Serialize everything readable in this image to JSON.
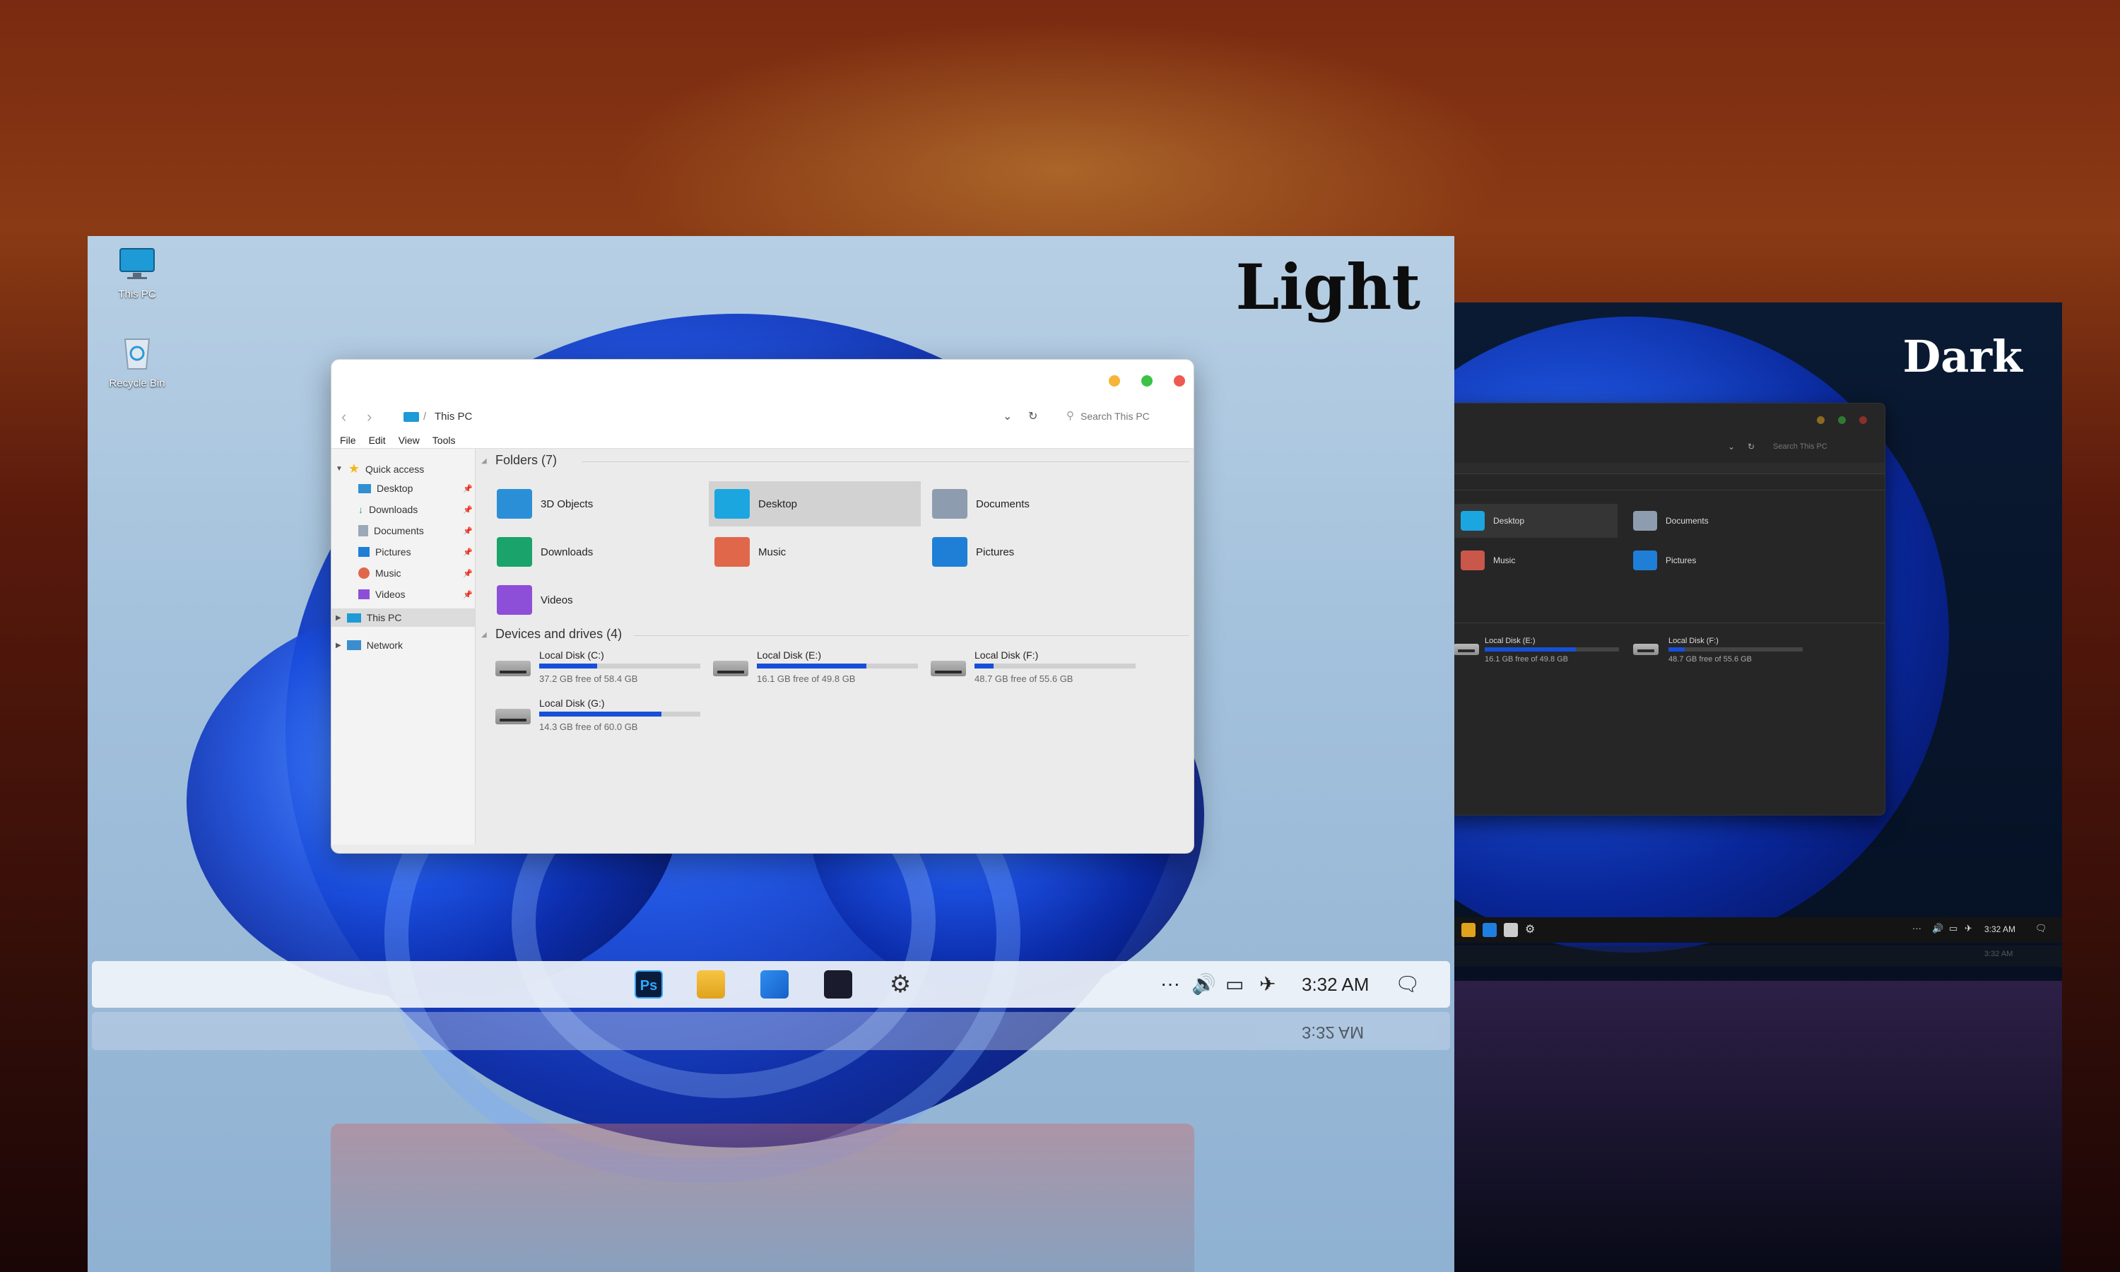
{
  "light": {
    "title": "Light",
    "desktop_icons": [
      {
        "label": "This PC",
        "icon": "monitor-icon"
      },
      {
        "label": "Recycle Bin",
        "icon": "recycle-bin-icon"
      }
    ],
    "window": {
      "breadcrumb": "This PC",
      "search_placeholder": "Search This PC",
      "menu": [
        "File",
        "Edit",
        "View",
        "Tools"
      ],
      "nav": {
        "quick_access": "Quick access",
        "pinned": [
          "Desktop",
          "Downloads",
          "Documents",
          "Pictures",
          "Music",
          "Videos"
        ],
        "this_pc": "This PC",
        "network": "Network"
      },
      "folders_header": "Folders (7)",
      "folders": [
        {
          "name": "3D Objects",
          "icon": "3d-objects-folder-icon"
        },
        {
          "name": "Desktop",
          "icon": "desktop-folder-icon",
          "selected": true
        },
        {
          "name": "Documents",
          "icon": "documents-folder-icon"
        },
        {
          "name": "Downloads",
          "icon": "downloads-folder-icon"
        },
        {
          "name": "Music",
          "icon": "music-folder-icon"
        },
        {
          "name": "Pictures",
          "icon": "pictures-folder-icon"
        },
        {
          "name": "Videos",
          "icon": "videos-folder-icon"
        }
      ],
      "drives_header": "Devices and drives (4)",
      "drives": [
        {
          "name": "Local Disk (C:)",
          "free": "37.2 GB free of 58.4 GB",
          "used_fraction": 0.36
        },
        {
          "name": "Local Disk (E:)",
          "free": "16.1 GB free of 49.8 GB",
          "used_fraction": 0.68
        },
        {
          "name": "Local Disk (F:)",
          "free": "48.7 GB free of 55.6 GB",
          "used_fraction": 0.12
        },
        {
          "name": "Local Disk (G:)",
          "free": "14.3 GB free of 60.0 GB",
          "used_fraction": 0.76
        }
      ]
    },
    "taskbar": {
      "apps": [
        "photoshop-icon",
        "file-explorer-icon",
        "windows-start-icon",
        "store-icon",
        "settings-icon"
      ],
      "photoshop_label": "Ps",
      "overflow": "···",
      "clock": "3:32 AM",
      "reflected_clock": "3:32 AM"
    }
  },
  "dark": {
    "title": "Dark",
    "window": {
      "search_placeholder": "Search This PC",
      "folders": [
        {
          "name": "Desktop",
          "selected": true
        },
        {
          "name": "Documents"
        },
        {
          "name": "Music"
        },
        {
          "name": "Pictures"
        }
      ],
      "drives": [
        {
          "name": "Local Disk (E:)",
          "free": "16.1 GB free of 49.8 GB",
          "used_fraction": 0.68
        },
        {
          "name": "Local Disk (F:)",
          "free": "48.7 GB free of 55.6 GB",
          "used_fraction": 0.12
        }
      ]
    },
    "taskbar": {
      "overflow": "···",
      "clock": "3:32 AM",
      "reflected_clock": "3:32 AM"
    }
  },
  "colors": {
    "accent": "#1750d8",
    "close": "#ee5a52",
    "minimize": "#f5b536",
    "maximize": "#3cc246"
  }
}
